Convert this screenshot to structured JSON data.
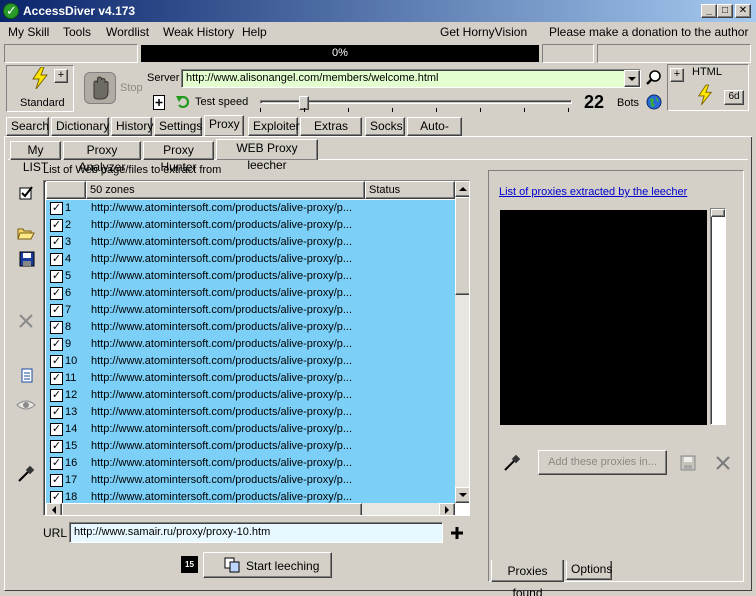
{
  "window": {
    "title": "AccessDiver v4.173",
    "controls": [
      "_",
      "□",
      "✕"
    ]
  },
  "menu": {
    "items": [
      "My Skill",
      "Tools",
      "Wordlist",
      "Weak History",
      "Help"
    ],
    "promo": "Get HornyVision",
    "donate": "Please make a donation to the author"
  },
  "progress": {
    "text": "0%",
    "value": 0
  },
  "toolbar": {
    "standard_label": "Standard",
    "stop_label": "Stop",
    "server_label": "Server",
    "server_value": "http://www.alisonangel.com/members/welcome.html",
    "test_speed_label": "Test speed",
    "bots_count": "22",
    "bots_label": "Bots",
    "html_label": "HTML",
    "speed_level": 0.14,
    "plus": "+",
    "counter_button": "6d"
  },
  "main_tabs": [
    "Search",
    "Dictionary",
    "History",
    "Settings",
    "Proxy",
    "Exploiter",
    "Extras tools",
    "Socks",
    "Auto-Pilot"
  ],
  "main_tabs_active": "Proxy",
  "sub_tabs": [
    "My LIST",
    "Proxy Analyzer",
    "Proxy Hunter",
    "WEB Proxy leecher"
  ],
  "sub_tabs_active": "WEB Proxy leecher",
  "leecher": {
    "list_caption": "List of Web page/files to extract from",
    "col_zones": "50 zones",
    "col_status": "Status",
    "rows": [
      {
        "num": "1",
        "checked": true,
        "url": "http://www.atomintersoft.com/products/alive-proxy/p..."
      },
      {
        "num": "2",
        "checked": true,
        "url": "http://www.atomintersoft.com/products/alive-proxy/p..."
      },
      {
        "num": "3",
        "checked": true,
        "url": "http://www.atomintersoft.com/products/alive-proxy/p..."
      },
      {
        "num": "4",
        "checked": true,
        "url": "http://www.atomintersoft.com/products/alive-proxy/p..."
      },
      {
        "num": "5",
        "checked": true,
        "url": "http://www.atomintersoft.com/products/alive-proxy/p..."
      },
      {
        "num": "6",
        "checked": true,
        "url": "http://www.atomintersoft.com/products/alive-proxy/p..."
      },
      {
        "num": "7",
        "checked": true,
        "url": "http://www.atomintersoft.com/products/alive-proxy/p..."
      },
      {
        "num": "8",
        "checked": true,
        "url": "http://www.atomintersoft.com/products/alive-proxy/p..."
      },
      {
        "num": "9",
        "checked": true,
        "url": "http://www.atomintersoft.com/products/alive-proxy/p..."
      },
      {
        "num": "10",
        "checked": true,
        "url": "http://www.atomintersoft.com/products/alive-proxy/p..."
      },
      {
        "num": "11",
        "checked": true,
        "url": "http://www.atomintersoft.com/products/alive-proxy/p..."
      },
      {
        "num": "12",
        "checked": true,
        "url": "http://www.atomintersoft.com/products/alive-proxy/p..."
      },
      {
        "num": "13",
        "checked": true,
        "url": "http://www.atomintersoft.com/products/alive-proxy/p..."
      },
      {
        "num": "14",
        "checked": true,
        "url": "http://www.atomintersoft.com/products/alive-proxy/p..."
      },
      {
        "num": "15",
        "checked": true,
        "url": "http://www.atomintersoft.com/products/alive-proxy/p..."
      },
      {
        "num": "16",
        "checked": true,
        "url": "http://www.atomintersoft.com/products/alive-proxy/p..."
      },
      {
        "num": "17",
        "checked": true,
        "url": "http://www.atomintersoft.com/products/alive-proxy/p..."
      },
      {
        "num": "18",
        "checked": true,
        "url": "http://www.atomintersoft.com/products/alive-proxy/p..."
      }
    ],
    "url_label": "URL",
    "url_value": "http://www.samair.ru/proxy/proxy-10.htm",
    "timer_badge": "15",
    "start_button": "Start leeching"
  },
  "right_panel": {
    "link": "List of proxies extracted by the leecher",
    "add_button": "Add these proxies in...",
    "tabs": [
      "Proxies found",
      "Options"
    ],
    "tabs_active": "Proxies found"
  },
  "icons": {
    "app": "green-check-icon",
    "lightning": "lightning-icon",
    "stop": "hand-stop-icon",
    "search": "magnifier-icon",
    "globe": "globe-icon",
    "add_page": "add-page-icon",
    "refresh": "refresh-arrow-icon",
    "check_all": "check-all-icon",
    "open": "folder-open-icon",
    "save": "floppy-save-icon",
    "delete": "delete-x-icon",
    "page": "page-icon",
    "eye": "eye-icon",
    "eyedropper": "eyedropper-icon",
    "plus": "plus-icon"
  },
  "colors": {
    "title_start": "#0a246a",
    "title_end": "#a6caf0",
    "face": "#d4d0c8",
    "grid_row": "#7cd0f8",
    "server_bg": "#e4ffcf",
    "url_bg": "#e8f8ff",
    "link": "#0000cc"
  }
}
